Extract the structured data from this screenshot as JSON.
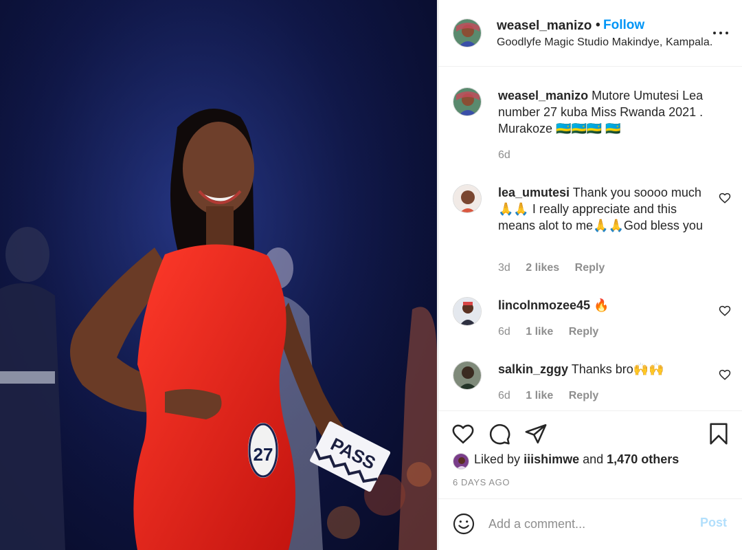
{
  "header": {
    "username": "weasel_manizo",
    "separator": "•",
    "follow_label": "Follow",
    "location": "Goodlyfe Magic Studio Makindye, Kampala."
  },
  "caption": {
    "username": "weasel_manizo",
    "text": "Mutore Umutesi Lea number 27 kuba Miss Rwanda 2021 . Murakoze 🇷🇼🇷🇼🇷🇼 🇷🇼",
    "time": "6d"
  },
  "comments": [
    {
      "username": "lea_umutesi",
      "text": "Thank you soooo much🙏🙏 I really appreciate and this means alot to me🙏🙏God bless you",
      "time": "3d",
      "likes": "2 likes",
      "reply": "Reply"
    },
    {
      "username": "lincolnmozee45",
      "text": "🔥",
      "time": "6d",
      "likes": "1 like",
      "reply": "Reply"
    },
    {
      "username": "salkin_zggy",
      "text": "Thanks bro🙌🙌",
      "time": "6d",
      "likes": "1 like",
      "reply": "Reply"
    }
  ],
  "liked_by": {
    "prefix": "Liked by",
    "user": "iiishimwe",
    "middle": "and",
    "others": "1,470 others"
  },
  "time_ago": "6 DAYS AGO",
  "add_comment": {
    "placeholder": "Add a comment...",
    "post_label": "Post"
  },
  "photo": {
    "bib_number": "27",
    "sign_text": "PASS"
  },
  "colors": {
    "link_blue": "#0095f6",
    "post_disabled": "#b2dffc",
    "muted_gray": "#8e8e8e",
    "text": "#262626",
    "dress_red": "#e8221c",
    "stage_blue": "#0f1646"
  },
  "icons": [
    "more-options-icon",
    "heart-icon",
    "comment-icon",
    "share-icon",
    "bookmark-icon",
    "smile-icon"
  ]
}
